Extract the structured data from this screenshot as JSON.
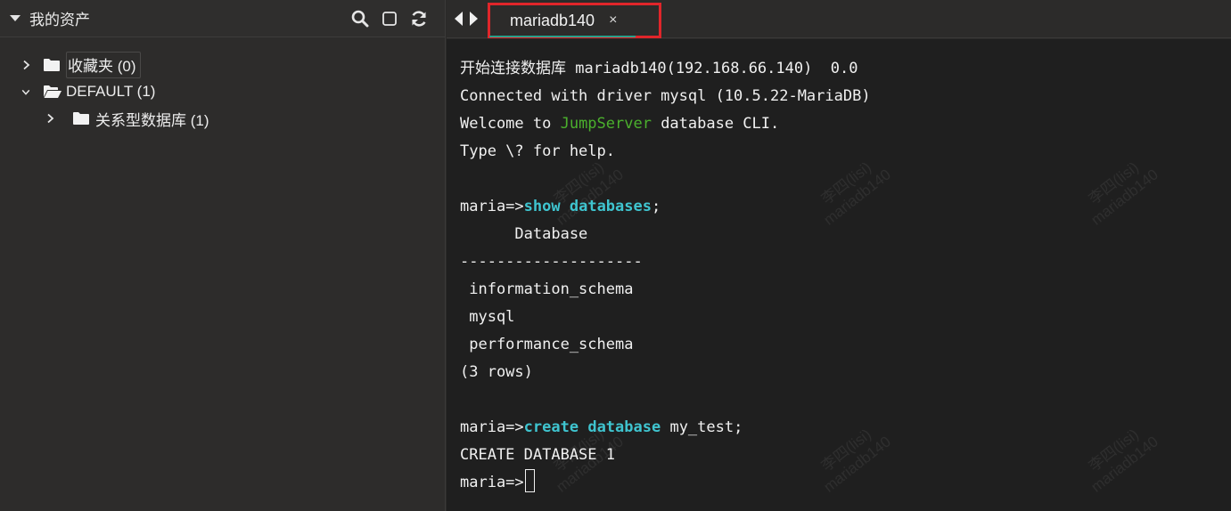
{
  "sidebar": {
    "title": "我的资产",
    "tools": [
      "search-icon",
      "square-icon",
      "refresh-icon"
    ],
    "tree": [
      {
        "label": "收藏夹 (0)",
        "expanded": false,
        "level": 0
      },
      {
        "label": "DEFAULT (1)",
        "expanded": true,
        "level": 0
      },
      {
        "label": "关系型数据库 (1)",
        "expanded": false,
        "level": 1
      }
    ]
  },
  "tabs": {
    "active": {
      "label": "mariadb140",
      "close": "×"
    }
  },
  "terminal": {
    "watermark": {
      "line1": "李四(lisi)",
      "line2": "mariadb140"
    },
    "lines": [
      {
        "segments": [
          {
            "t": "开始连接数据库 mariadb140(192.168.66.140)  0.0",
            "c": ""
          }
        ]
      },
      {
        "segments": [
          {
            "t": "Connected with driver mysql (10.5.22-MariaDB)",
            "c": ""
          }
        ]
      },
      {
        "segments": [
          {
            "t": "Welcome to ",
            "c": ""
          },
          {
            "t": "JumpServer",
            "c": "hl-green"
          },
          {
            "t": " database CLI.",
            "c": ""
          }
        ]
      },
      {
        "segments": [
          {
            "t": "Type \\? for help.",
            "c": ""
          }
        ]
      },
      {
        "segments": [
          {
            "t": "",
            "c": ""
          }
        ]
      },
      {
        "segments": [
          {
            "t": "maria=>",
            "c": ""
          },
          {
            "t": "show",
            "c": "hl-cyan"
          },
          {
            "t": " ",
            "c": ""
          },
          {
            "t": "databases",
            "c": "hl-cyan"
          },
          {
            "t": ";",
            "c": ""
          }
        ]
      },
      {
        "segments": [
          {
            "t": "      Database",
            "c": ""
          }
        ]
      },
      {
        "segments": [
          {
            "t": "--------------------",
            "c": ""
          }
        ]
      },
      {
        "segments": [
          {
            "t": " information_schema",
            "c": ""
          }
        ]
      },
      {
        "segments": [
          {
            "t": " mysql",
            "c": ""
          }
        ]
      },
      {
        "segments": [
          {
            "t": " performance_schema",
            "c": ""
          }
        ]
      },
      {
        "segments": [
          {
            "t": "(3 rows)",
            "c": ""
          }
        ]
      },
      {
        "segments": [
          {
            "t": "",
            "c": ""
          }
        ]
      },
      {
        "segments": [
          {
            "t": "maria=>",
            "c": ""
          },
          {
            "t": "create",
            "c": "hl-cyan"
          },
          {
            "t": " ",
            "c": ""
          },
          {
            "t": "database",
            "c": "hl-cyan"
          },
          {
            "t": " my_test;",
            "c": ""
          }
        ]
      },
      {
        "segments": [
          {
            "t": "CREATE DATABASE 1",
            "c": ""
          }
        ]
      },
      {
        "segments": [
          {
            "t": "maria=>",
            "c": ""
          }
        ],
        "cursor": true
      }
    ]
  },
  "colors": {
    "tab_highlight": "#e0252a",
    "keyword": "#3fc4cf",
    "brand": "#4bb02d",
    "tab_underline": "#2aa08a"
  }
}
